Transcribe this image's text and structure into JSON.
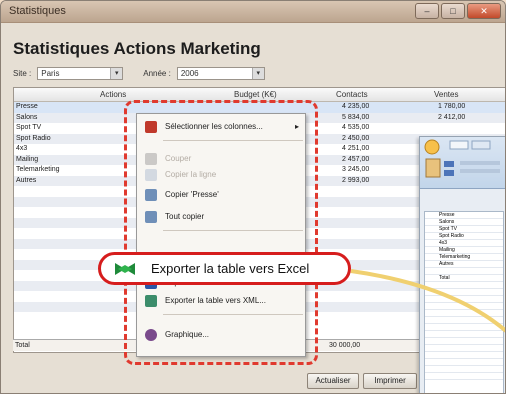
{
  "window": {
    "title": "Statistiques",
    "minimize": "–",
    "maximize": "□",
    "close": "✕"
  },
  "header": {
    "title": "Statistiques Actions Marketing"
  },
  "filters": {
    "site_label": "Site :",
    "site_value": "Paris",
    "year_label": "Année :",
    "year_value": "2006"
  },
  "table": {
    "columns": [
      "Actions",
      "Budget (K€)",
      "Contacts",
      "Ventes"
    ],
    "rows": [
      {
        "action": "Presse",
        "contacts": "4 235,00",
        "ventes": "1 780,00"
      },
      {
        "action": "Salons",
        "contacts": "5 834,00",
        "ventes": "2 412,00"
      },
      {
        "action": "Spot TV",
        "contacts": "4 535,00",
        "ventes": ""
      },
      {
        "action": "Spot Radio",
        "contacts": "2 450,00",
        "ventes": ""
      },
      {
        "action": "4x3",
        "contacts": "4 251,00",
        "ventes": ""
      },
      {
        "action": "Mailing",
        "contacts": "2 457,00",
        "ventes": ""
      },
      {
        "action": "Telemarketing",
        "contacts": "3 245,00",
        "ventes": ""
      },
      {
        "action": "Autres",
        "contacts": "2 993,00",
        "ventes": ""
      }
    ],
    "total_label": "Total",
    "total_contacts": "30 000,00"
  },
  "context_menu": {
    "items": [
      {
        "label": "Sélectionner les colonnes...",
        "enabled": true,
        "icon": "columns-icon",
        "submenu": "▸"
      },
      {
        "label": "Couper",
        "enabled": false,
        "icon": "cut-icon"
      },
      {
        "label": "Copier la ligne",
        "enabled": false,
        "icon": "copy-row-icon"
      },
      {
        "label": "Copier 'Presse'",
        "enabled": true,
        "icon": "copy-icon"
      },
      {
        "label": "Tout copier",
        "enabled": true,
        "icon": "copy-all-icon"
      },
      {
        "label": "Exporter la table vers Excel",
        "enabled": true,
        "icon": "excel-icon"
      },
      {
        "label": "Exporter la table vers Word...",
        "enabled": true,
        "icon": "word-icon"
      },
      {
        "label": "Exporter la table vers XML...",
        "enabled": true,
        "icon": "xml-icon"
      },
      {
        "label": "Graphique...",
        "enabled": true,
        "icon": "chart-icon"
      }
    ]
  },
  "buttons": {
    "refresh": "Actualiser",
    "print": "Imprimer"
  },
  "excel_preview": {
    "rows": [
      "Presse",
      "Salons",
      "Spot TV",
      "Spot Radio",
      "4x3",
      "Mailing",
      "Telemarketing",
      "Autres",
      "",
      "Total"
    ]
  },
  "colors": {
    "accent_red": "#e03a2f",
    "excel_green": "#1f8a3a",
    "arrow_yellow": "#f0d070"
  }
}
